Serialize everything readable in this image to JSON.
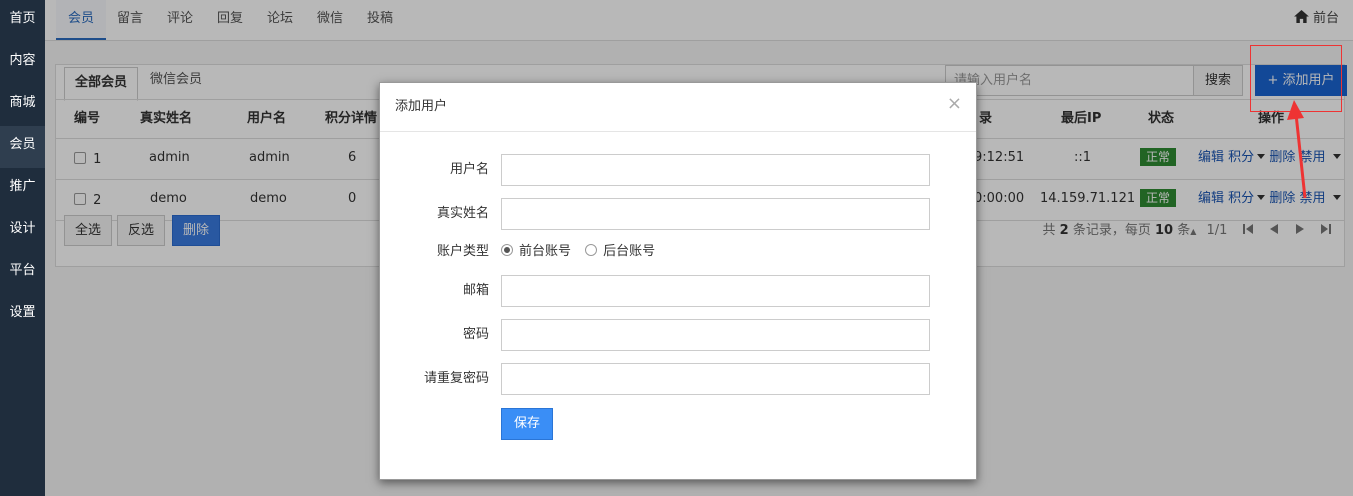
{
  "sidebar": {
    "items": [
      "首页",
      "内容",
      "商城",
      "会员",
      "推广",
      "设计",
      "平台",
      "设置"
    ],
    "active": 3
  },
  "topnav": {
    "tabs": [
      "会员",
      "留言",
      "评论",
      "回复",
      "论坛",
      "微信",
      "投稿"
    ],
    "front_label": "前台"
  },
  "panel": {
    "tabs": [
      "全部会员",
      "微信会员"
    ],
    "search_placeholder": "请输入用户名",
    "search_label": "搜索",
    "add_user_label": "+ 添加用户"
  },
  "table": {
    "columns": [
      "编号",
      "真实姓名",
      "用户名",
      "积分详情",
      "录",
      "最后IP",
      "状态",
      "操作"
    ],
    "rows": [
      {
        "id": "1",
        "realname": "admin",
        "username": "admin",
        "points": "6",
        "time": "9:12:51",
        "ip": "::1",
        "status": "正常"
      },
      {
        "id": "2",
        "realname": "demo",
        "username": "demo",
        "points": "0",
        "time": "0:00:00",
        "ip": "14.159.71.121",
        "status": "正常"
      }
    ],
    "ops": {
      "edit": "编辑",
      "points": "积分",
      "delete": "删除",
      "disable": "禁用"
    }
  },
  "footer": {
    "select_all": "全选",
    "invert": "反选",
    "delete": "删除",
    "pager_prefix": "共",
    "total": "2",
    "pager_mid": "条记录，每页",
    "per_page": "10",
    "pager_suffix": "条",
    "page": "1/1"
  },
  "modal": {
    "title": "添加用户",
    "close": "×",
    "fields": {
      "username": "用户名",
      "realname": "真实姓名",
      "account_type": "账户类型",
      "email": "邮箱",
      "password": "密码",
      "password_repeat": "请重复密码"
    },
    "radio_front": "前台账号",
    "radio_back": "后台账号",
    "save": "保存"
  },
  "colors": {
    "sidebar": "#1f2d3d",
    "primary": "#1a64d2",
    "status_ok": "#2e8b32",
    "annotation": "#e33333"
  }
}
